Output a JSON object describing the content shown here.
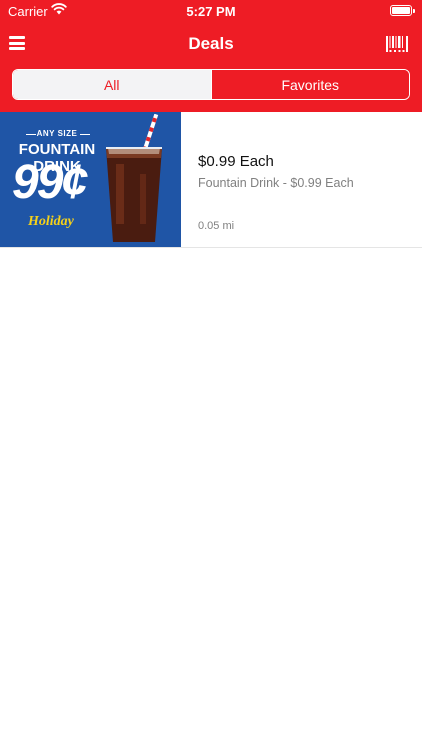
{
  "status_bar": {
    "carrier": "Carrier",
    "time": "5:27 PM"
  },
  "nav": {
    "title": "Deals",
    "left_icon": "menu-icon",
    "right_icon": "barcode-icon"
  },
  "tabs": {
    "items": [
      {
        "label": "All",
        "selected": true
      },
      {
        "label": "Favorites",
        "selected": false
      }
    ]
  },
  "deals": [
    {
      "title": "$0.99 Each",
      "subtitle": "Fountain Drink - $0.99 Each",
      "distance": "0.05 mi",
      "image": {
        "tagline": "ANY SIZE",
        "headline": "FOUNTAIN DRINK",
        "price": "99¢",
        "brand": "Holiday"
      }
    }
  ],
  "colors": {
    "brand_red": "#ee1c25",
    "image_blue": "#1f55a6",
    "brand_yellow": "#f6d21a"
  }
}
